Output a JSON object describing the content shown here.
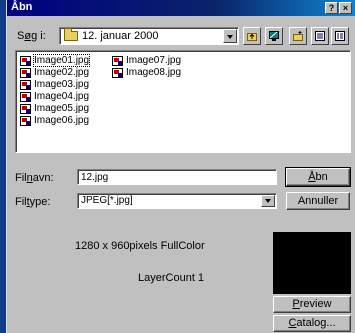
{
  "window": {
    "title": "Åbn",
    "help_label": "?",
    "close_label": "×"
  },
  "search": {
    "label_pre": "S",
    "label_ul": "ø",
    "label_post": "g i:",
    "folder": "12. januar 2000"
  },
  "toolbar": {
    "icons": [
      "up-folder-icon",
      "desktop-icon",
      "new-folder-icon",
      "list-view-icon",
      "details-view-icon"
    ]
  },
  "files": [
    {
      "name": "Image01.jpg",
      "selected": true
    },
    {
      "name": "Image02.jpg"
    },
    {
      "name": "Image03.jpg"
    },
    {
      "name": "Image04.jpg"
    },
    {
      "name": "Image05.jpg"
    },
    {
      "name": "Image06.jpg"
    },
    {
      "name": "Image07.jpg"
    },
    {
      "name": "Image08.jpg"
    }
  ],
  "filename": {
    "label_pre": "Fil",
    "label_ul": "n",
    "label_post": "avn:",
    "value": "12.jpg"
  },
  "filetype": {
    "label_pre": "Fil",
    "label_ul": "t",
    "label_post": "ype:",
    "value": "JPEG[*.jpg]"
  },
  "buttons": {
    "open_pre": "Å",
    "open_post": "bn",
    "cancel": "Annuller",
    "preview": "Preview",
    "preview_ul": "P",
    "preview_post": "review",
    "catalog_ul": "C",
    "catalog_post": "atalog..."
  },
  "info": {
    "resolution": "1280 x 960pixels FullColor",
    "layers": "LayerCount 1"
  },
  "colors": {
    "title_bar": "#000080",
    "face": "#c0c0c0",
    "preview_bg": "#000000"
  }
}
